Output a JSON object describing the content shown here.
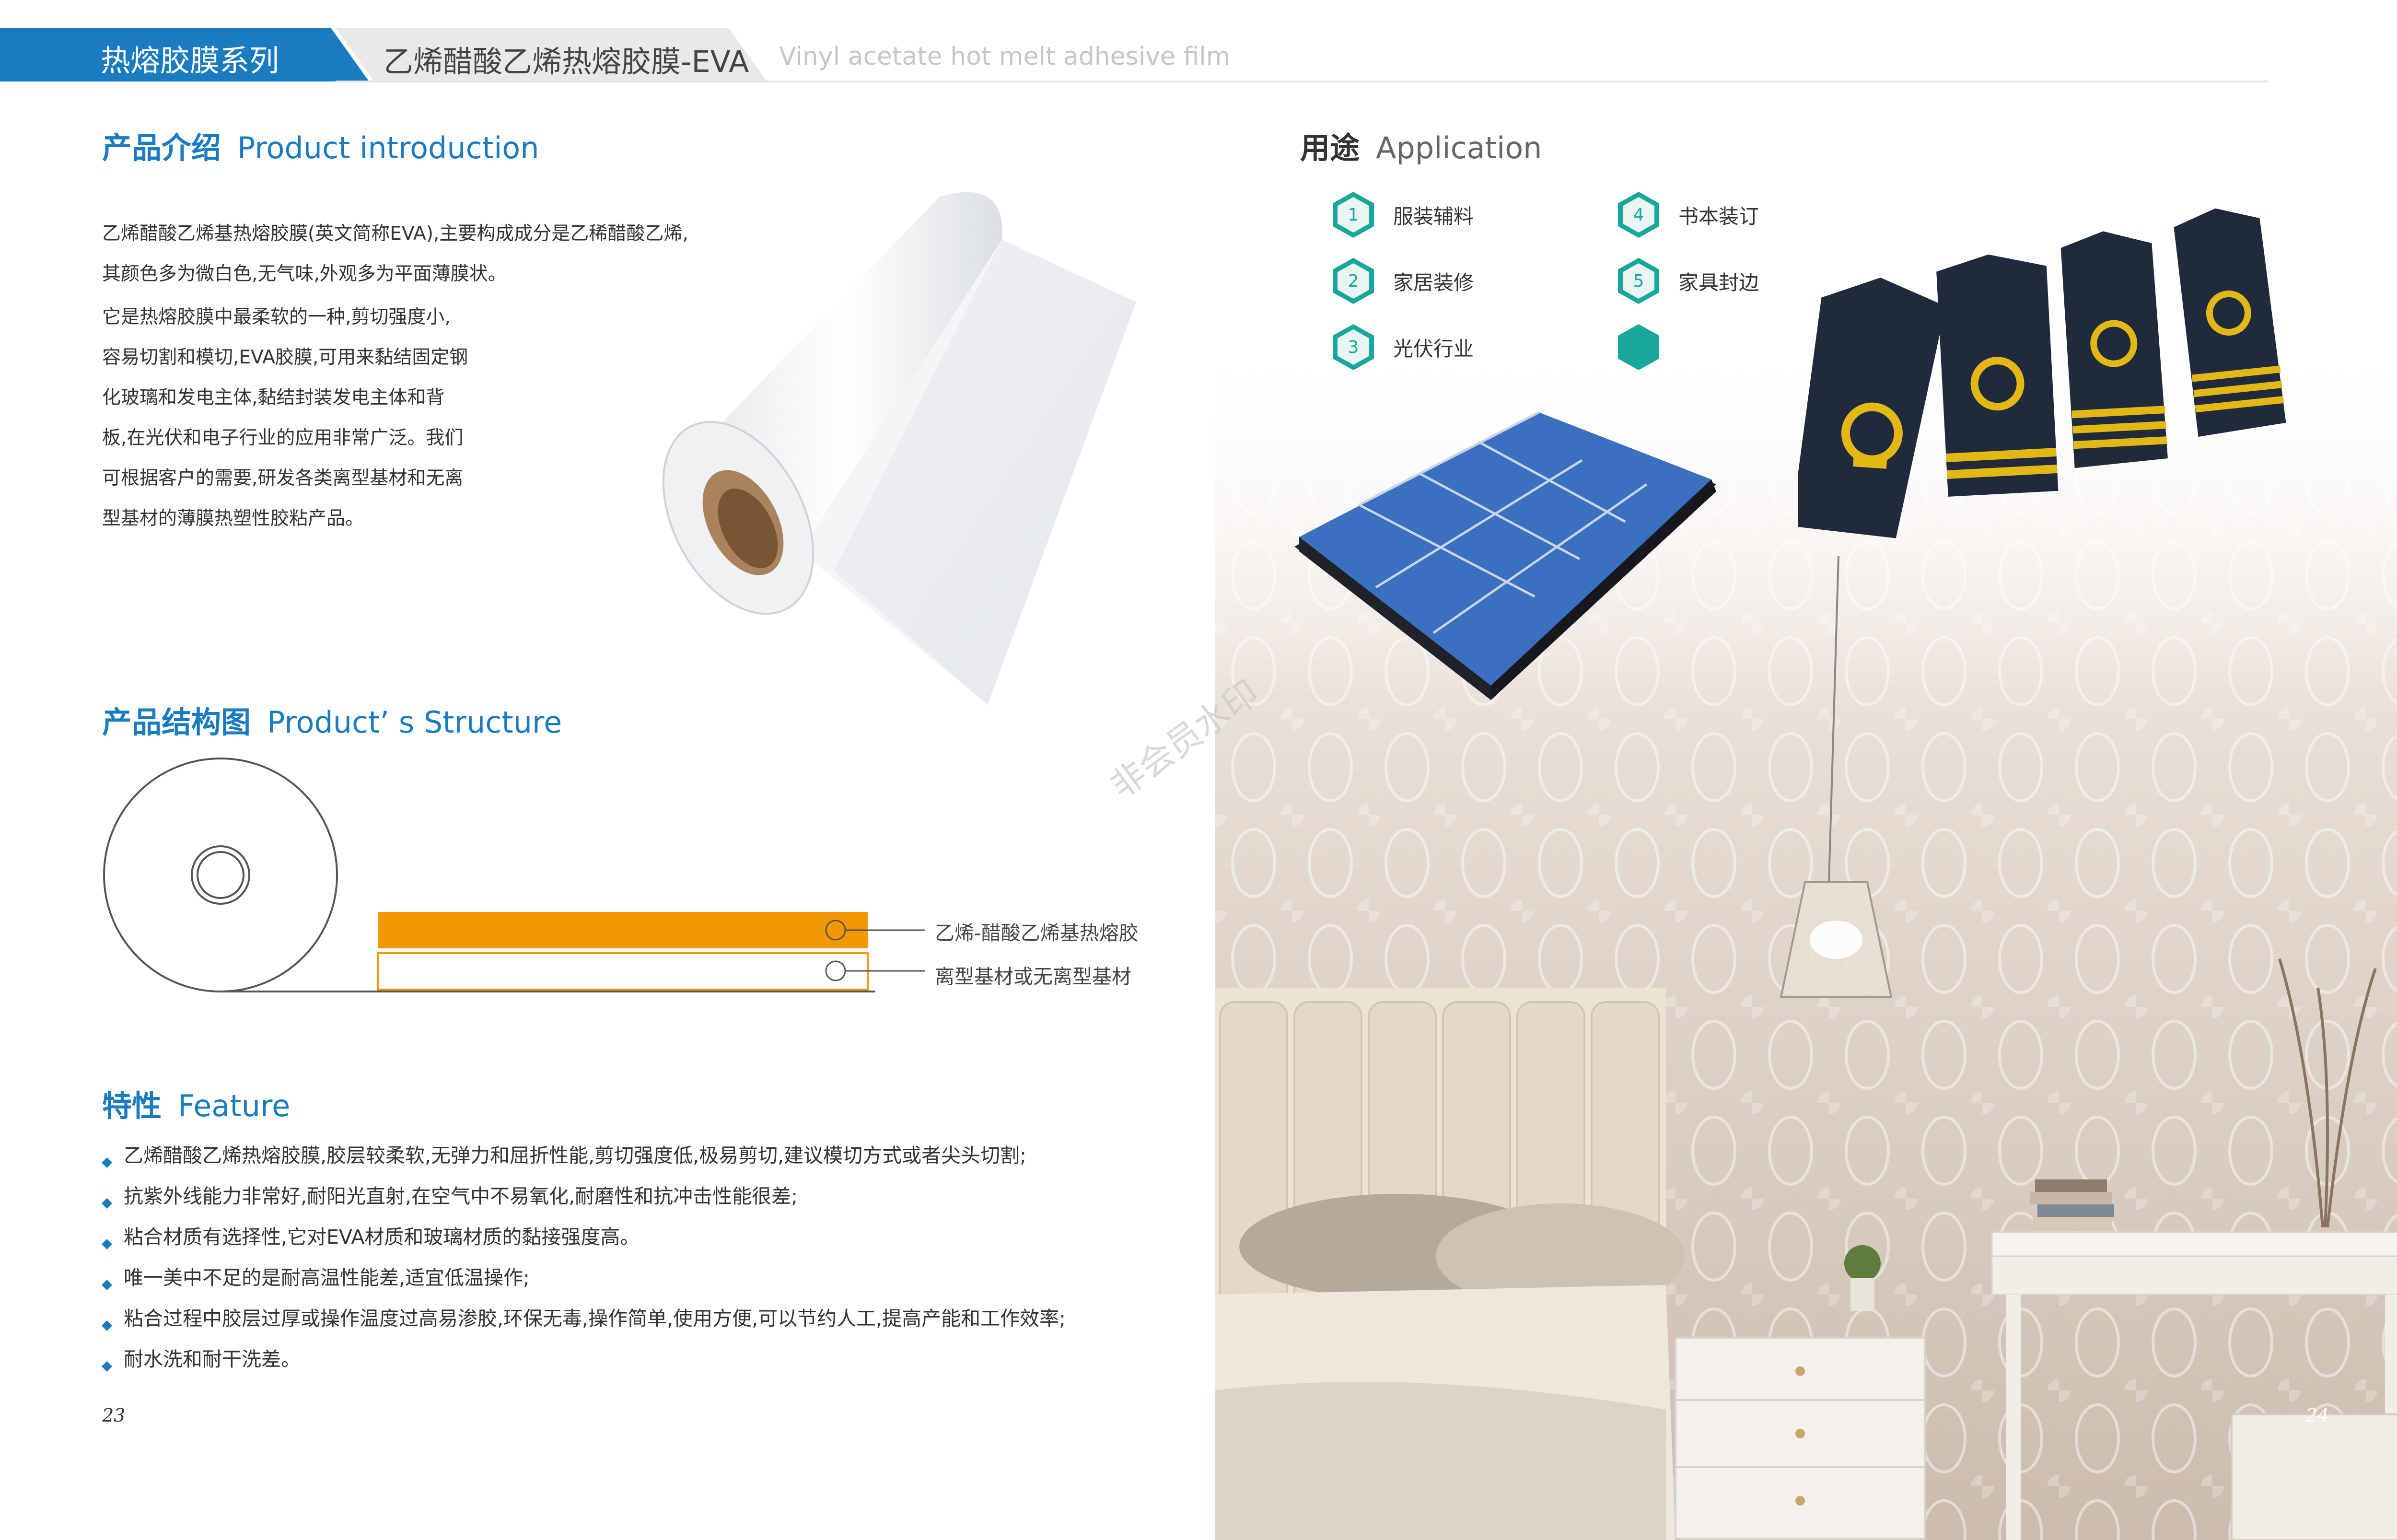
{
  "header": {
    "series_label": "热熔胶膜系列",
    "product_title": "乙烯醋酸乙烯热熔胶膜-EVA",
    "product_subtitle": "Vinyl acetate hot melt adhesive film"
  },
  "intro": {
    "title_cn": "产品介绍",
    "title_en": "Product introduction",
    "paragraph1": [
      "乙烯醋酸乙烯基热熔胶膜(英文简称EVA),主要构成成分是乙稀醋酸乙烯,",
      "其颜色多为微白色,无气味,外观多为平面薄膜状。"
    ],
    "paragraph2": [
      "它是热熔胶膜中最柔软的一种,剪切强度小,",
      "容易切割和模切,EVA胶膜,可用来黏结固定钢",
      "化玻璃和发电主体,黏结封装发电主体和背",
      "板,在光伏和电子行业的应用非常广泛。我们",
      "可根据客户的需要,研发各类离型基材和无离",
      "型基材的薄膜热塑性胶粘产品。"
    ]
  },
  "structure": {
    "title_cn": "产品结构图",
    "title_en": "Product’ s Structure",
    "layer_adhesive": "乙烯-醋酸乙烯基热熔胶",
    "layer_release": "离型基材或无离型基材",
    "adhesive_color": "#f39800"
  },
  "feature": {
    "title_cn": "特性",
    "title_en": "Feature",
    "items": [
      "乙烯醋酸乙烯热熔胶膜,胶层较柔软,无弹力和屈折性能,剪切强度低,极易剪切,建议模切方式或者尖头切割;",
      "抗紫外线能力非常好,耐阳光直射,在空气中不易氧化,耐磨性和抗冲击性能很差;",
      "粘合材质有选择性,它对EVA材质和玻璃材质的黏接强度高。",
      "唯一美中不足的是耐高温性能差,适宜低温操作;",
      "粘合过程中胶层过厚或操作温度过高易渗胶,环保无毒,操作简单,使用方便,可以节约人工,提高产能和工作效率;",
      "耐水洗和耐干洗差。"
    ]
  },
  "application": {
    "title_cn": "用途",
    "title_en": "Application",
    "items": [
      {
        "num": "1",
        "label": "服装辅料"
      },
      {
        "num": "4",
        "label": "书本装订"
      },
      {
        "num": "2",
        "label": "家居装修"
      },
      {
        "num": "5",
        "label": "家具封边"
      },
      {
        "num": "3",
        "label": "光伏行业"
      },
      {
        "num": "",
        "label": ""
      }
    ]
  },
  "watermark": "非会员水印",
  "page_left": "23",
  "page_right": "24",
  "colors": {
    "brand_blue": "#1a7bc1",
    "teal": "#18a89b",
    "orange": "#f39800"
  }
}
